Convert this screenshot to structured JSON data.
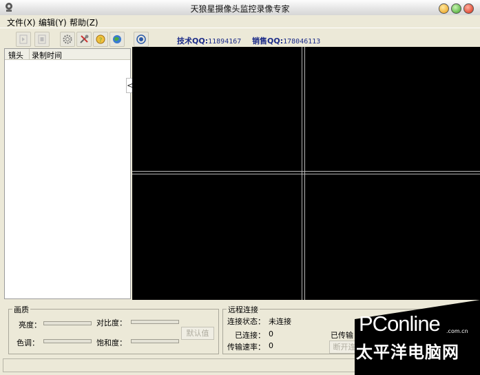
{
  "window": {
    "title": "天狼星摄像头监控录像专家"
  },
  "menu": [
    {
      "label": "文件",
      "hotkey": "(X)"
    },
    {
      "label": "编辑",
      "hotkey": "(Y)"
    },
    {
      "label": "帮助",
      "hotkey": "(Z)"
    }
  ],
  "toolbar": {
    "tech_qq_label": "技术QQ:",
    "tech_qq": "11894167",
    "sales_qq_label": "销售QQ:",
    "sales_qq": "178046113"
  },
  "camera_list": {
    "columns": [
      "镜头",
      "录制时间"
    ],
    "collapse_glyph": "<<"
  },
  "quality": {
    "title": "画质",
    "brightness": "亮度：",
    "contrast": "对比度：",
    "hue": "色调：",
    "saturation": "饱和度：",
    "default_button": "默认值"
  },
  "remote": {
    "title": "远程连接",
    "status_label": "连接状态：",
    "status_value": "未连接",
    "connected_label": "已连接：",
    "connected_value": "0",
    "speed_label": "传输速率：",
    "speed_value": "0",
    "transferred_label": "已传输",
    "disconnect_button": "断开连"
  },
  "watermark": {
    "brand": "PConline",
    "suffix": ".com.cn",
    "chinese": "太平洋电脑网"
  },
  "colors": {
    "accent_blue": "#1b2b88",
    "window_bg": "#ece9d8",
    "video_bg": "#000000"
  }
}
